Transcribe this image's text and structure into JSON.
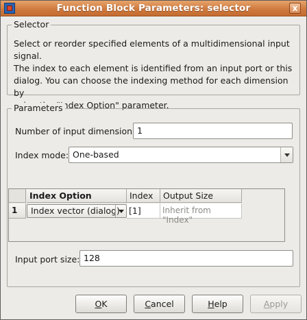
{
  "window": {
    "title": "Function Block Parameters: selector",
    "close_glyph": "x",
    "app_icon": "simulink-block-icon"
  },
  "selector_group": {
    "legend": "Selector",
    "description_lines": [
      "Select or reorder specified elements of a multidimensional input signal.",
      "The index to each element is identified from an input port or this",
      "dialog. You can choose the indexing method for each dimension by",
      "using the \"Index Option\" parameter."
    ]
  },
  "parameters_group": {
    "legend": "Parameters",
    "num_dims_label": "Number of input dimensions:",
    "num_dims_value": "1",
    "index_mode_label": "Index mode:",
    "index_mode_value": "One-based",
    "table": {
      "columns": [
        "Index Option",
        "Index",
        "Output Size"
      ],
      "rows": [
        {
          "row_number": "1",
          "index_option": "Index vector (dialog)",
          "index": "[1]",
          "output_size": "Inherit from \"Index\""
        }
      ]
    },
    "input_port_size_label": "Input port size:",
    "input_port_size_value": "128"
  },
  "buttons": {
    "ok": {
      "mnemonic": "O",
      "rest": "K"
    },
    "cancel": {
      "mnemonic": "C",
      "rest": "ancel"
    },
    "help": {
      "mnemonic": "H",
      "rest": "elp"
    },
    "apply": {
      "mnemonic": "A",
      "rest": "pply"
    }
  }
}
